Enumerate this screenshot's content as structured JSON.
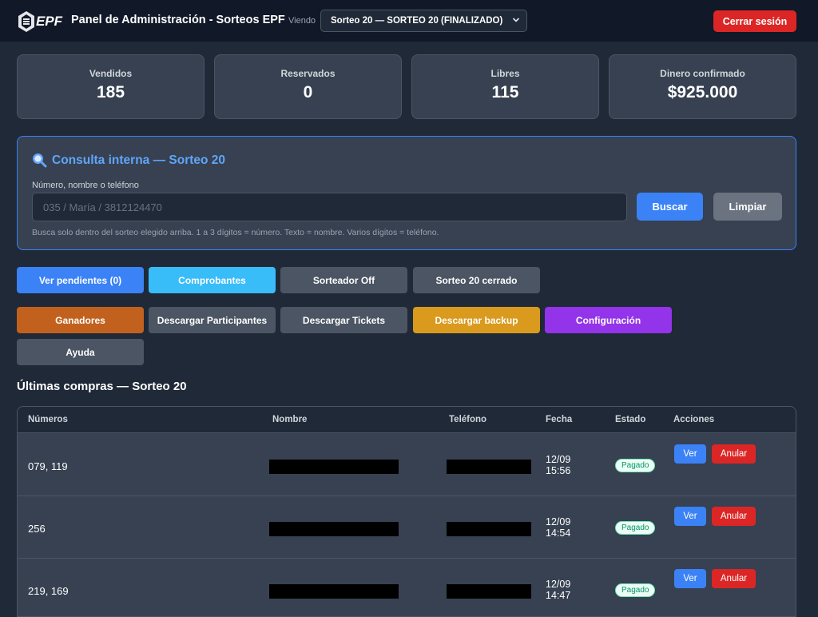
{
  "header": {
    "logo_text": "EPF",
    "title": "Panel de Administración - Sorteos EPF",
    "viewing_label": "Viendo",
    "selected_draw": "Sorteo 20 — SORTEO 20 (FINALIZADO)",
    "logout_label": "Cerrar sesión"
  },
  "stats": [
    {
      "label": "Vendidos",
      "value": "185"
    },
    {
      "label": "Reservados",
      "value": "0"
    },
    {
      "label": "Libres",
      "value": "115"
    },
    {
      "label": "Dinero confirmado",
      "value": "$925.000"
    }
  ],
  "query": {
    "title": "Consulta interna — Sorteo 20",
    "field_label": "Número, nombre o teléfono",
    "placeholder": "035 / María / 3812124470",
    "value": "",
    "search_label": "Buscar",
    "clear_label": "Limpiar",
    "hint": "Busca solo dentro del sorteo elegido arriba. 1 a 3 dígitos = número. Texto = nombre. Varios dígitos = teléfono."
  },
  "actions": {
    "pending": "Ver pendientes (0)",
    "receipts": "Comprobantes",
    "drawer": "Sorteador Off",
    "closed": "Sorteo 20 cerrado",
    "winners": "Ganadores",
    "download_participants": "Descargar Participantes",
    "download_tickets": "Descargar Tickets",
    "download_backup": "Descargar backup",
    "settings": "Configuración",
    "help": "Ayuda"
  },
  "recent": {
    "title": "Últimas compras — Sorteo 20",
    "columns": {
      "numbers": "Números",
      "name": "Nombre",
      "phone": "Teléfono",
      "date": "Fecha",
      "status": "Estado",
      "actions": "Acciones"
    },
    "view_label": "Ver",
    "cancel_label": "Anular",
    "rows": [
      {
        "numbers": "079, 119",
        "date": "12/09",
        "time": "15:56",
        "status": "Pagado"
      },
      {
        "numbers": "256",
        "date": "12/09",
        "time": "14:54",
        "status": "Pagado"
      },
      {
        "numbers": "219, 169",
        "date": "12/09",
        "time": "14:47",
        "status": "Pagado"
      }
    ]
  },
  "icons": {
    "logo": "epf-logo-icon",
    "select": "chevron-down-icon",
    "search": "magnifier-icon"
  },
  "colors": {
    "background": "#1f2937",
    "header": "#111827",
    "card": "#374151",
    "accent_blue": "#3b82f6",
    "danger": "#dc2626",
    "cyan": "#38bdf8",
    "orange": "#c2611e",
    "amber": "#d99a1e",
    "purple": "#9333ea",
    "paid_badge": "#059669"
  }
}
